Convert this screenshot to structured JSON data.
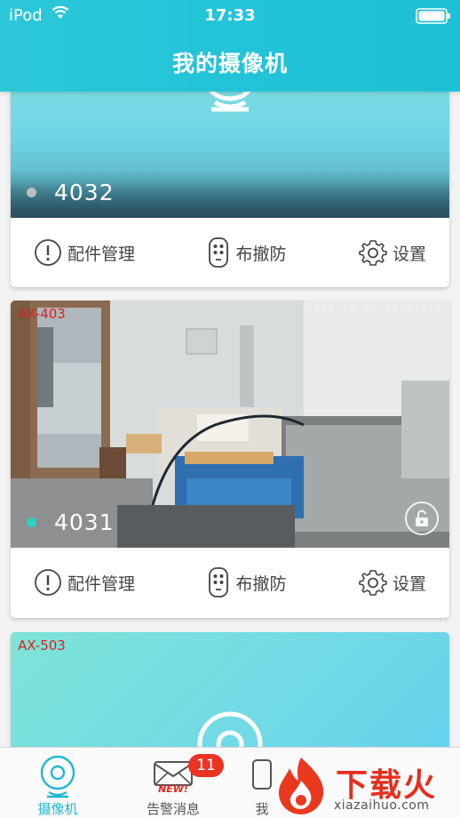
{
  "status_bar": {
    "carrier": "iPod",
    "time": "17:33"
  },
  "header": {
    "title": "我的摄像机"
  },
  "cameras": [
    {
      "name": "4032",
      "status_color": "#bfbfbf",
      "actions": {
        "accessories": "配件管理",
        "arm_disarm": "布撤防",
        "settings": "设置"
      }
    },
    {
      "model": "AX-403",
      "timestamp": "2015 10 19 17:32:39",
      "name": "4031",
      "status_color": "#2bd3c2",
      "actions": {
        "accessories": "配件管理",
        "arm_disarm": "布撤防",
        "settings": "设置"
      }
    },
    {
      "model": "AX-503"
    }
  ],
  "tabbar": {
    "camera_label": "摄像机",
    "alerts_label": "告警消息",
    "alerts_badge": "11",
    "alerts_new": "NEW!",
    "mine_label": "我"
  },
  "watermark": {
    "text": "下载火",
    "url": "xiazaihuo.com"
  },
  "colors": {
    "accent": "#22c3d7",
    "badge": "#ea3323",
    "model_tag": "#d8231f"
  }
}
